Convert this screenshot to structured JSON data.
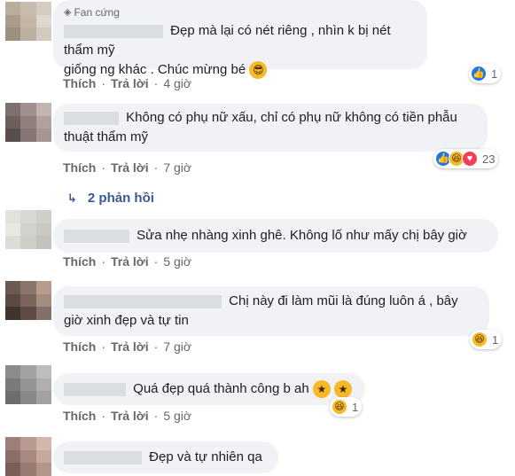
{
  "comments": [
    {
      "badge": "Fan cứng",
      "text_line1": "Đẹp mà lại có nét riêng , nhìn k bị nét thẩm mỹ",
      "text_line2": "giống ng khác . Chúc mừng bé",
      "inline_emoji": "sunglasses-emoji",
      "actions": {
        "like": "Thích",
        "reply": "Trả lời",
        "time": "4 giờ"
      },
      "reactions": {
        "icons": [
          "like"
        ],
        "count": "1"
      },
      "avatar_colors": [
        "#b9ad9e",
        "#c7bcae",
        "#d6cdc2",
        "#a99c8d",
        "#c3b6a7",
        "#e0d8cf",
        "#9e9081",
        "#bcb0a2",
        "#d3cac0"
      ]
    },
    {
      "text_line1": "Không có phụ nữ xấu, chỉ có phụ nữ không có tiền phẫu",
      "text_line2": "thuật thẩm mỹ",
      "actions": {
        "like": "Thích",
        "reply": "Trả lời",
        "time": "7 giờ"
      },
      "reactions": {
        "icons": [
          "like",
          "haha",
          "love"
        ],
        "count": "23"
      },
      "replies_label": "2 phản hồi",
      "avatar_colors": [
        "#7f7070",
        "#a08f8f",
        "#c2b4b0",
        "#6e5f5f",
        "#8e7e7c",
        "#b1a19e",
        "#5a4d4d",
        "#857574",
        "#a69693"
      ]
    },
    {
      "text_line1": "Sửa nhẹ nhàng xinh ghê. Không lố như mấy chị bây giờ",
      "actions": {
        "like": "Thích",
        "reply": "Trả lời",
        "time": "5 giờ"
      },
      "avatar_colors": [
        "#e2e1dc",
        "#d8d7d2",
        "#cfcec8",
        "#e8e7e2",
        "#d2d1cb",
        "#c9c8c2",
        "#dedcd6",
        "#cecdc7",
        "#c3c2bc"
      ]
    },
    {
      "text_line1": "Chị này đi làm mũi là đúng luôn á , bây",
      "text_line2": "giờ xinh đẹp và tự tin",
      "actions": {
        "like": "Thích",
        "reply": "Trả lời",
        "time": "7 giờ"
      },
      "reactions": {
        "icons": [
          "haha"
        ],
        "count": "1"
      },
      "avatar_colors": [
        "#6c5a52",
        "#8b7468",
        "#b59c8c",
        "#5b4a44",
        "#7b655b",
        "#a58d7e",
        "#3f3330",
        "#5e4b44",
        "#84706a"
      ]
    },
    {
      "text_line1": "Quá đẹp quá thành công b ah",
      "inline_emoji": "star-struck-emoji",
      "actions": {
        "like": "Thích",
        "reply": "Trả lời",
        "time": "5 giờ"
      },
      "reactions": {
        "icons": [
          "haha"
        ],
        "count": "1"
      },
      "avatar_colors": [
        "#8c8a8d",
        "#a3a1a4",
        "#bebcbf",
        "#7b797c",
        "#959396",
        "#b0aeb1",
        "#6e6c6f",
        "#888689",
        "#a2a0a3"
      ]
    },
    {
      "text_line1": "Đẹp và tự nhiên qa",
      "avatar_colors": [
        "#9c7f77",
        "#b99a90",
        "#d1b7ad",
        "#8a6e67",
        "#a8897f",
        "#c6a89d",
        "#7a5f59",
        "#977a72",
        "#b4958b"
      ]
    }
  ]
}
